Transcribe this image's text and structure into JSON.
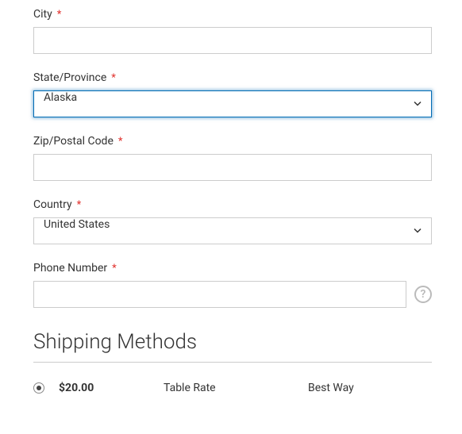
{
  "fields": {
    "city": {
      "label": "City",
      "value": ""
    },
    "state": {
      "label": "State/Province",
      "value": "Alaska"
    },
    "zip": {
      "label": "Zip/Postal Code",
      "value": ""
    },
    "country": {
      "label": "Country",
      "value": "United States"
    },
    "phone": {
      "label": "Phone Number",
      "value": ""
    }
  },
  "required_mark": "*",
  "help_glyph": "?",
  "shipping": {
    "title": "Shipping Methods",
    "methods": [
      {
        "price": "$20.00",
        "rate": "Table Rate",
        "carrier": "Best Way",
        "selected": true
      }
    ]
  }
}
